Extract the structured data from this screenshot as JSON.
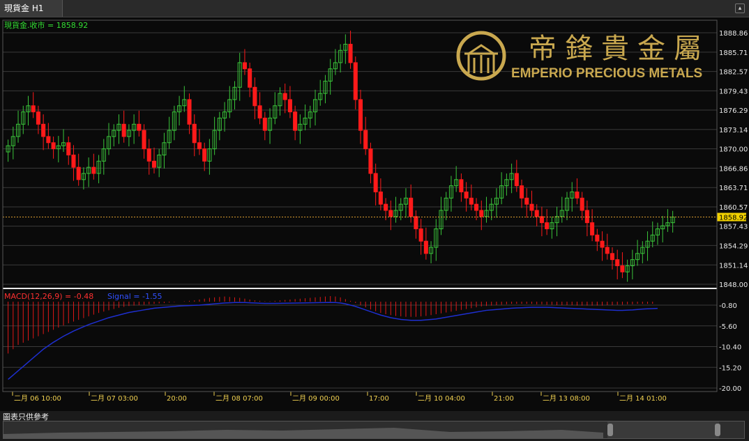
{
  "tab": {
    "label": "現貨金 H1",
    "collapse_icon": "chevron-up-icon"
  },
  "legend": {
    "label": "現貨金.收市 = 1858.92"
  },
  "price_axis": {
    "ticks": [
      "1888.86",
      "1885.71",
      "1882.57",
      "1879.43",
      "1876.29",
      "1873.14",
      "1870.00",
      "1866.86",
      "1863.71",
      "1860.57",
      "1857.43",
      "1854.29",
      "1851.14",
      "1848.00"
    ],
    "current_price": "1858.92"
  },
  "logo": {
    "chinese": "帝鋒貴金屬",
    "english": "EMPERIO PRECIOUS METALS"
  },
  "macd": {
    "label": "MACD(12,26,9) = -0.48",
    "signal_label": "Signal = -1.55",
    "ticks": [
      "-0.80",
      "-5.60",
      "-10.40",
      "-15.20",
      "-20.00"
    ]
  },
  "time_axis": [
    "二月 06 10:00",
    "二月 07 03:00",
    "20:00",
    "二月 08 07:00",
    "二月 09 00:00",
    "17:00",
    "二月 10 04:00",
    "21:00",
    "二月 13 08:00",
    "二月 14 01:00"
  ],
  "footer": {
    "note": "圖表只供參考"
  },
  "colors": {
    "up": "#3ac43a",
    "down": "#ff1a1a",
    "signal": "#1e2fd0",
    "gold": "#c9a84f",
    "dotline": "#e0a030"
  },
  "chart_data": {
    "type": "candlestick",
    "instrument": "現貨金",
    "timeframe": "H1",
    "last_close": 1858.92,
    "ylim": [
      1848.0,
      1890.0
    ],
    "closes": [
      1870.5,
      1872,
      1874,
      1876,
      1877,
      1876,
      1874,
      1872,
      1871,
      1870,
      1870.5,
      1871,
      1869,
      1867,
      1865,
      1866,
      1867,
      1866,
      1868,
      1870,
      1872,
      1873,
      1874,
      1872,
      1873,
      1874,
      1873,
      1870,
      1868,
      1867,
      1869,
      1871,
      1873,
      1876,
      1877,
      1878,
      1874,
      1871,
      1870,
      1868,
      1870,
      1873,
      1875,
      1876,
      1878,
      1880,
      1884,
      1883,
      1880,
      1877,
      1875,
      1873,
      1875,
      1877,
      1879,
      1878,
      1876,
      1873,
      1874,
      1875,
      1876,
      1878,
      1879,
      1881,
      1883,
      1884,
      1886,
      1887,
      1884,
      1878,
      1873,
      1870,
      1866,
      1863,
      1861,
      1860,
      1859,
      1860,
      1861,
      1862,
      1859,
      1857,
      1855,
      1853,
      1854,
      1857,
      1860,
      1862,
      1864,
      1865,
      1863,
      1862,
      1861,
      1860,
      1859,
      1860,
      1861,
      1862,
      1864,
      1865,
      1866,
      1864,
      1862,
      1861,
      1860,
      1859,
      1858,
      1857,
      1858,
      1859,
      1860,
      1862,
      1863,
      1862,
      1860,
      1858,
      1856,
      1855,
      1854,
      1853,
      1852,
      1851,
      1850,
      1851,
      1852,
      1853,
      1854,
      1855,
      1856,
      1857,
      1857.5,
      1858,
      1858.92
    ],
    "macd": {
      "hist": [
        -12,
        -11,
        -10,
        -9.5,
        -9,
        -8.5,
        -8,
        -7.5,
        -7,
        -6.5,
        -6,
        -5.5,
        -5,
        -4.6,
        -4.2,
        -3.8,
        -3.4,
        -3,
        -2.6,
        -2.3,
        -2,
        -1.7,
        -1.4,
        -1.2,
        -1,
        -0.9,
        -0.8,
        -0.7,
        -0.6,
        -0.5,
        -0.4,
        -0.3,
        -0.2,
        -0.1,
        0,
        0.1,
        0.2,
        0.3,
        0.5,
        0.7,
        0.9,
        1.0,
        1.1,
        1.2,
        1.1,
        1.0,
        0.9,
        0.7,
        0.5,
        0.3,
        0.2,
        0.1,
        0.1,
        0.2,
        0.3,
        0.4,
        0.5,
        0.6,
        0.7,
        0.8,
        0.9,
        1.0,
        1.1,
        1.2,
        1.3,
        1.2,
        1.0,
        0.6,
        0.2,
        -0.3,
        -0.8,
        -1.3,
        -1.8,
        -2.2,
        -2.6,
        -2.9,
        -3.1,
        -3.3,
        -3.4,
        -3.5,
        -3.5,
        -3.5,
        -3.4,
        -3.3,
        -3.1,
        -2.9,
        -2.7,
        -2.5,
        -2.3,
        -2.1,
        -1.9,
        -1.7,
        -1.5,
        -1.3,
        -1.1,
        -1.0,
        -0.9,
        -0.8,
        -0.7,
        -0.6,
        -0.5,
        -0.5,
        -0.5,
        -0.5,
        -0.5,
        -0.6,
        -0.6,
        -0.7,
        -0.7,
        -0.8,
        -0.8,
        -0.8,
        -0.8,
        -0.9,
        -0.9,
        -0.9,
        -0.9,
        -0.9,
        -0.9,
        -0.8,
        -0.8,
        -0.7,
        -0.7,
        -0.6,
        -0.6,
        -0.5,
        -0.5,
        -0.5,
        -0.48
      ],
      "signal": [
        -18,
        -17,
        -16,
        -15,
        -14,
        -13,
        -12,
        -11,
        -10.2,
        -9.4,
        -8.7,
        -8,
        -7.4,
        -6.8,
        -6.3,
        -5.8,
        -5.3,
        -4.9,
        -4.5,
        -4.1,
        -3.7,
        -3.4,
        -3.1,
        -2.8,
        -2.5,
        -2.3,
        -2.1,
        -1.9,
        -1.7,
        -1.5,
        -1.4,
        -1.3,
        -1.2,
        -1.1,
        -1,
        -0.95,
        -0.9,
        -0.85,
        -0.8,
        -0.7,
        -0.6,
        -0.5,
        -0.4,
        -0.3,
        -0.25,
        -0.2,
        -0.2,
        -0.2,
        -0.25,
        -0.3,
        -0.35,
        -0.4,
        -0.4,
        -0.4,
        -0.38,
        -0.36,
        -0.34,
        -0.32,
        -0.3,
        -0.28,
        -0.26,
        -0.24,
        -0.22,
        -0.2,
        -0.18,
        -0.2,
        -0.3,
        -0.5,
        -0.8,
        -1.1,
        -1.5,
        -1.9,
        -2.3,
        -2.7,
        -3.1,
        -3.4,
        -3.7,
        -3.9,
        -4.1,
        -4.2,
        -4.3,
        -4.3,
        -4.3,
        -4.2,
        -4.1,
        -4.0,
        -3.8,
        -3.6,
        -3.4,
        -3.2,
        -3.0,
        -2.8,
        -2.6,
        -2.4,
        -2.2,
        -2.0,
        -1.9,
        -1.8,
        -1.7,
        -1.6,
        -1.5,
        -1.45,
        -1.4,
        -1.35,
        -1.3,
        -1.3,
        -1.3,
        -1.3,
        -1.35,
        -1.4,
        -1.45,
        -1.5,
        -1.55,
        -1.6,
        -1.65,
        -1.7,
        -1.75,
        -1.8,
        -1.85,
        -1.9,
        -1.95,
        -2.0,
        -2.0,
        -1.95,
        -1.9,
        -1.8,
        -1.7,
        -1.65,
        -1.6,
        -1.55
      ]
    }
  }
}
